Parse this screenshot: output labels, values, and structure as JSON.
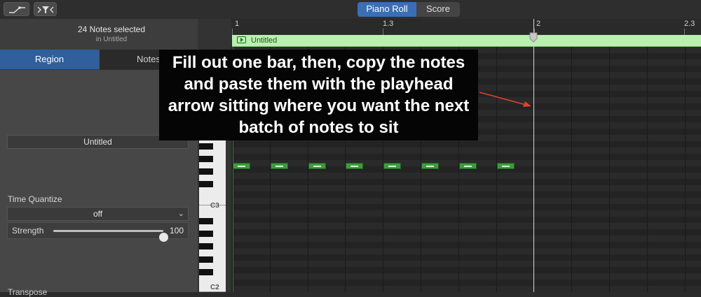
{
  "toolbar": {
    "icons": [
      "automation-icon",
      "midi-filter-icon"
    ],
    "view_tabs": [
      {
        "label": "Piano Roll",
        "selected": true
      },
      {
        "label": "Score",
        "selected": false
      }
    ]
  },
  "inspector": {
    "selection_count": "24 Notes selected",
    "selection_source": "in Untitled",
    "tabs": [
      {
        "label": "Region",
        "selected": true
      },
      {
        "label": "Notes",
        "selected": false
      }
    ],
    "region_name": "Untitled",
    "time_quantize_label": "Time Quantize",
    "time_quantize_value": "off",
    "strength_label": "Strength",
    "strength_value": "100",
    "strength_fraction": 1.0,
    "transpose_label": "Transpose"
  },
  "keyboard": {
    "octave_labels": [
      "C3",
      "C2"
    ]
  },
  "ruler": {
    "marks": [
      "1",
      "1.3",
      "2",
      "2.3"
    ]
  },
  "region": {
    "name": "Untitled",
    "color": "#b9f0b0"
  },
  "notes": {
    "visible_count": 8,
    "color": "#3f9a3f"
  },
  "annotation": {
    "text": "Fill out one bar, then, copy the notes and paste them with the playhead arrow sitting where you want the next batch of notes to sit",
    "arrow_color": "#e0412a"
  },
  "colors": {
    "accent": "#3a6fb4",
    "background": "#252525"
  }
}
